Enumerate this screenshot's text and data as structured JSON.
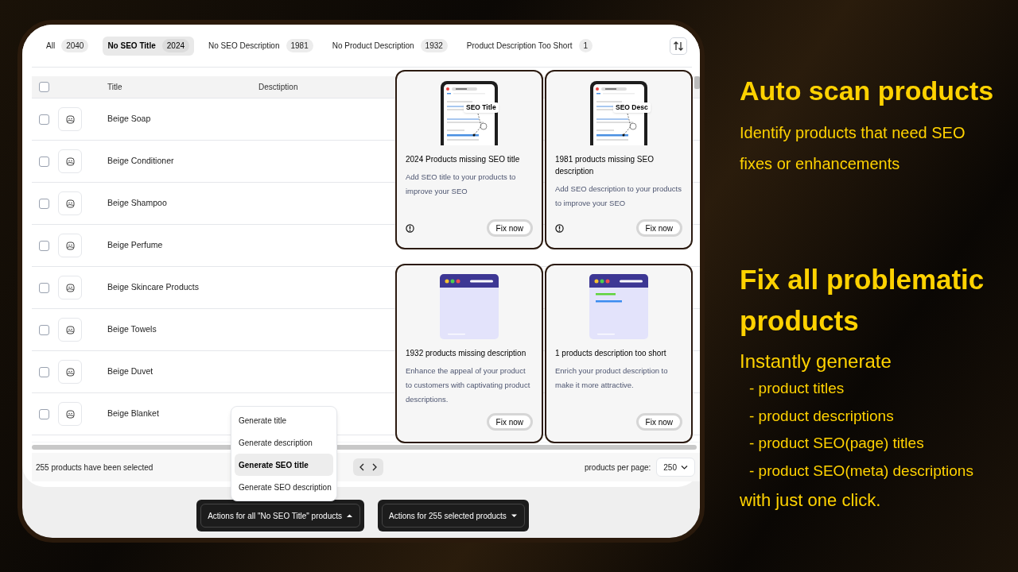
{
  "tabs": [
    {
      "label": "All",
      "count": "2040",
      "selected": false
    },
    {
      "label": "No SEO Title",
      "count": "2024",
      "selected": true
    },
    {
      "label": "No SEO Description",
      "count": "1981",
      "selected": false
    },
    {
      "label": "No Product Description",
      "count": "1932",
      "selected": false
    },
    {
      "label": "Product Description Too Short",
      "count": "1",
      "selected": false
    }
  ],
  "table": {
    "header_checked": false,
    "columns": [
      "Title",
      "Desctiption"
    ],
    "rows": [
      {
        "title": "Beige Soap",
        "checked": false
      },
      {
        "title": "Beige Conditioner",
        "checked": false
      },
      {
        "title": "Beige Shampoo",
        "checked": false
      },
      {
        "title": "Beige Perfume",
        "checked": false
      },
      {
        "title": "Beige Skincare Products",
        "checked": false
      },
      {
        "title": "Beige Towels",
        "checked": false
      },
      {
        "title": "Beige Duvet",
        "checked": false
      },
      {
        "title": "Beige Blanket",
        "checked": false
      }
    ]
  },
  "cards": [
    {
      "kind": "phone",
      "callout": "SEO Title",
      "title": "2024 Products missing SEO title",
      "description": "Add SEO title to your products to improve your SEO",
      "warning": true,
      "button": "Fix now"
    },
    {
      "kind": "phone",
      "callout": "SEO Desc",
      "title": "1981 products missing SEO description",
      "description": "Add SEO description to your products to improve your SEO",
      "warning": true,
      "button": "Fix now"
    },
    {
      "kind": "browser_empty",
      "title": "1932 products missing description",
      "description": "Enhance the appeal of your product to customers with captivating product descriptions.",
      "warning": false,
      "button": "Fix now"
    },
    {
      "kind": "browser_short",
      "title": "1 products description too short",
      "description": "Enrich your product description to make it more attractive.",
      "warning": false,
      "button": "Fix now"
    }
  ],
  "footer": {
    "selection": "255 products have been selected",
    "per_page_label": "products per page:",
    "per_page_value": "250"
  },
  "menu": {
    "items": [
      {
        "label": "Generate title",
        "selected": false
      },
      {
        "label": "Generate description",
        "selected": false
      },
      {
        "label": "Generate SEO title",
        "selected": true
      },
      {
        "label": "Generate SEO description",
        "selected": false
      }
    ]
  },
  "action_buttons": [
    {
      "label": "Actions for all \"No SEO Title\" products",
      "expanded": true
    },
    {
      "label": "Actions for 255 selected products",
      "expanded": false
    }
  ],
  "promo": [
    {
      "heading": "Auto scan products",
      "lead": "Identify products that need SEO fixes or enhancements"
    },
    {
      "heading": "Fix all problematic products",
      "lead": "Instantly generate",
      "list": [
        "- product titles",
        "- product descriptions",
        "- product SEO(page) titles",
        "- product SEO(meta) descriptions"
      ],
      "closing": "with just one click."
    }
  ]
}
